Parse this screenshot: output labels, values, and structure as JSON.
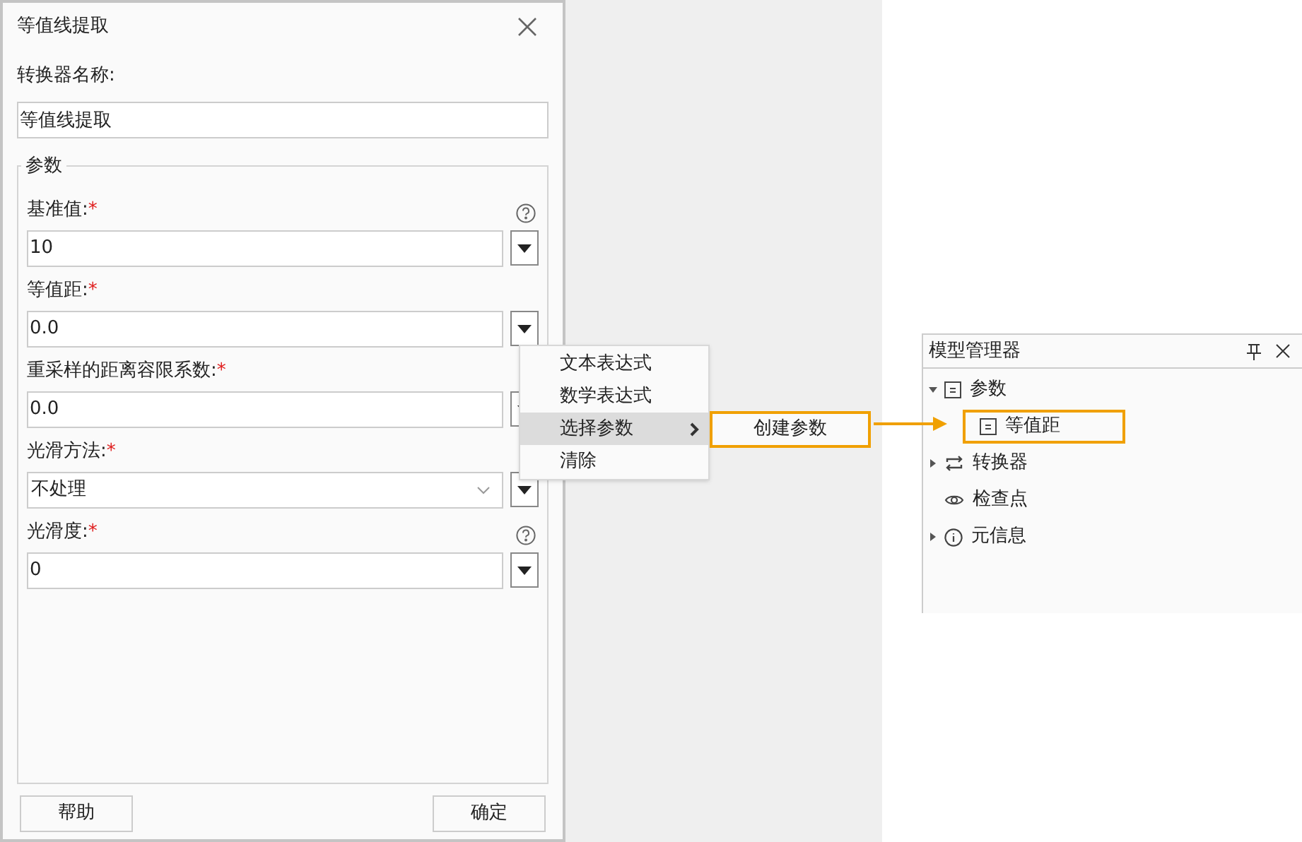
{
  "dialog": {
    "title": "等值线提取",
    "name_label": "转换器名称:",
    "name_value": "等值线提取",
    "group_title": "参数",
    "params": [
      {
        "label": "基准值:",
        "required_mark": "*",
        "help": true,
        "kind": "text",
        "value": "10"
      },
      {
        "label": "等值距:",
        "required_mark": "*",
        "help": false,
        "kind": "text",
        "value": "0.0"
      },
      {
        "label": "重采样的距离容限系数:",
        "required_mark": "*",
        "help": false,
        "kind": "text",
        "value": "0.0"
      },
      {
        "label": "光滑方法:",
        "required_mark": "*",
        "help": false,
        "kind": "select",
        "value": "不处理"
      },
      {
        "label": "光滑度:",
        "required_mark": "*",
        "help": true,
        "kind": "text",
        "value": "0"
      }
    ],
    "buttons": [
      "帮助",
      "确定"
    ]
  },
  "context_menu": {
    "items": [
      {
        "label": "文本表达式",
        "selected": false,
        "submenu": false
      },
      {
        "label": "数学表达式",
        "selected": false,
        "submenu": false
      },
      {
        "label": "选择参数",
        "selected": true,
        "submenu": true
      },
      {
        "label": "清除",
        "selected": false,
        "submenu": false
      }
    ],
    "submenu_items": [
      "创建参数"
    ]
  },
  "model_manager": {
    "title": "模型管理器",
    "tree": [
      {
        "label": "参数",
        "kind": "param",
        "expanded": true,
        "has_children": true,
        "children": [
          {
            "label": "等值距",
            "kind": "param",
            "highlighted": true
          }
        ]
      },
      {
        "label": "转换器",
        "kind": "convert",
        "expanded": false,
        "has_children": true
      },
      {
        "label": "检查点",
        "kind": "eye",
        "has_children": false
      },
      {
        "label": "元信息",
        "kind": "info",
        "expanded": false,
        "has_children": true
      }
    ]
  }
}
